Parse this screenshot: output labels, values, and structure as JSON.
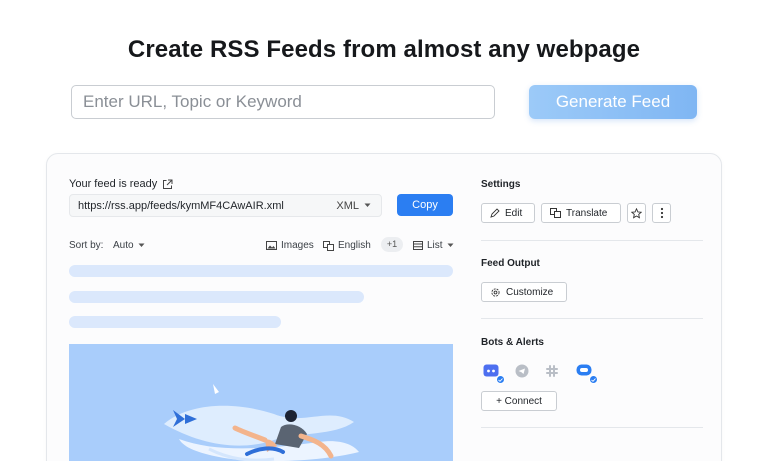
{
  "headline": "Create RSS Feeds from almost any webpage",
  "search": {
    "placeholder": "Enter URL, Topic or Keyword",
    "value": ""
  },
  "generate_button": "Generate Feed",
  "feed": {
    "ready_label": "Your feed is ready",
    "url": "https://rss.app/feeds/kymMF4CAwAIR.xml",
    "format": "XML",
    "copy_label": "Copy"
  },
  "toolbar": {
    "sort_label": "Sort by:",
    "sort_value": "Auto",
    "images_label": "Images",
    "language_label": "English",
    "extra_count": "+1",
    "view_label": "List"
  },
  "settings": {
    "title": "Settings",
    "edit_label": "Edit",
    "translate_label": "Translate"
  },
  "feed_output": {
    "title": "Feed Output",
    "customize_label": "Customize"
  },
  "bots": {
    "title": "Bots & Alerts",
    "items": [
      "discord-icon",
      "telegram-icon",
      "slack-icon",
      "chat-icon"
    ],
    "connect_label": "+ Connect"
  },
  "colors": {
    "accent": "#2b7ef2",
    "generate_gradient_start": "#9ccaf8",
    "skeleton": "#dbe8fc",
    "hero_background": "#a9cdfb"
  }
}
